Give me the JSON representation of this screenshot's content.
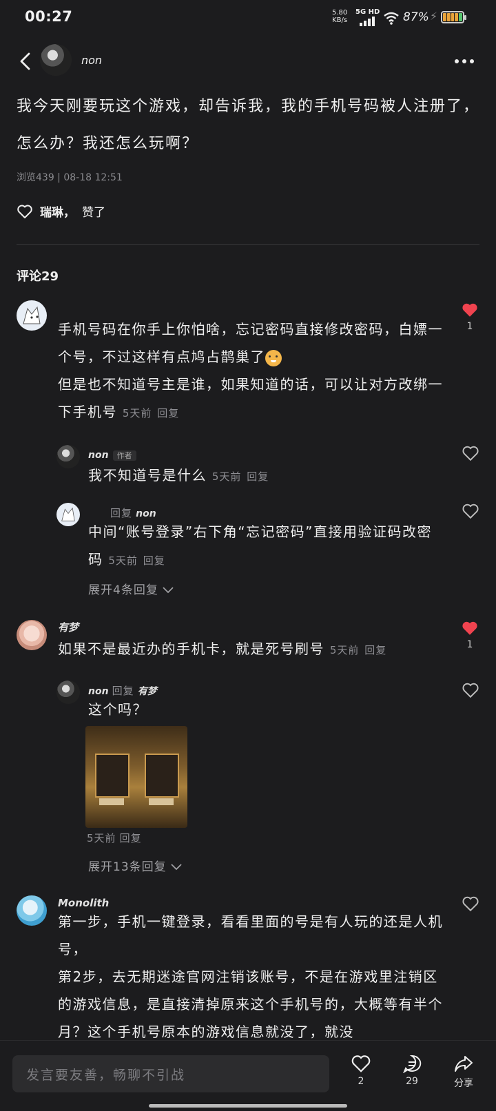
{
  "status": {
    "time": "00:27",
    "net_speed_top": "5.80",
    "net_speed_bottom": "KB/s",
    "signal": "5G HD",
    "battery": "87%"
  },
  "header": {
    "username": "non"
  },
  "post": {
    "text": "我今天刚要玩这个游戏，却告诉我，我的手机号码被人注册了，怎么办？我还怎么玩啊？",
    "meta": "浏览439 | 08-18 12:51",
    "likers": "瑞琳，",
    "liked_suffix": "赞了"
  },
  "comments_title": "评论29",
  "comments": [
    {
      "text1": "手机号码在你手上你怕啥，忘记密码直接修改密码，白嫖一个号，不过这样有点鸠占鹊巢了",
      "text2": "但是也不知道号主是谁，如果知道的话，可以让对方改绑一下手机号",
      "time": "5天前",
      "reply": "回复",
      "likes": "1",
      "replies": [
        {
          "name": "non",
          "tag": "作者",
          "text": "我不知道号是什么",
          "time": "5天前",
          "reply": "回复"
        },
        {
          "prefix": "回复",
          "target": "non",
          "text": "中间“账号登录”右下角“忘记密码”直接用验证码改密码",
          "time": "5天前",
          "reply": "回复"
        }
      ],
      "expand": "展开4条回复"
    },
    {
      "name": "有梦",
      "text": "如果不是最近办的手机卡，就是死号刷号",
      "time": "5天前",
      "reply": "回复",
      "likes": "1",
      "replies": [
        {
          "name": "non",
          "prefix": "回复",
          "target": "有梦",
          "text": "这个吗？",
          "time": "5天前",
          "reply": "回复"
        }
      ],
      "expand": "展开13条回复"
    },
    {
      "name": "Monolith",
      "text1": "第一步，手机一键登录，看看里面的号是有人玩的还是人机号，",
      "text2": "第2步，去无期迷途官网注销该账号，不是在游戏里注销区的游戏信息，是直接清掉原来这个手机号的，大概等有半个月？这个手机号原本的游戏信息就没了，就没"
    }
  ],
  "bottom": {
    "input_placeholder": "发言要友善，畅聊不引战",
    "like_count": "2",
    "comment_count": "29",
    "share_label": "分享"
  },
  "colors": {
    "background": "#1c1c1e",
    "liked_heart": "#f0434f"
  }
}
